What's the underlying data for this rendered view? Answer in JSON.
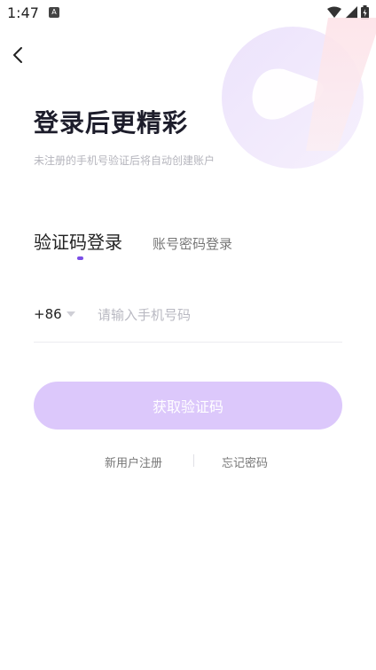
{
  "status_bar": {
    "time": "1:47",
    "notification_badge": "A",
    "icons": [
      "wifi-icon",
      "signal-icon",
      "battery-icon"
    ]
  },
  "header": {
    "title": "登录后更精彩",
    "subtitle": "未注册的手机号验证后将自动创建账户"
  },
  "tabs": {
    "active": "验证码登录",
    "inactive": "账号密码登录"
  },
  "phone": {
    "country_code": "+86",
    "placeholder": "请输入手机号码",
    "value": ""
  },
  "actions": {
    "get_code_label": "获取验证码",
    "register_label": "新用户注册",
    "forgot_label": "忘记密码"
  },
  "colors": {
    "accent": "#7b4ee6",
    "button_disabled": "#dcc8fb"
  }
}
